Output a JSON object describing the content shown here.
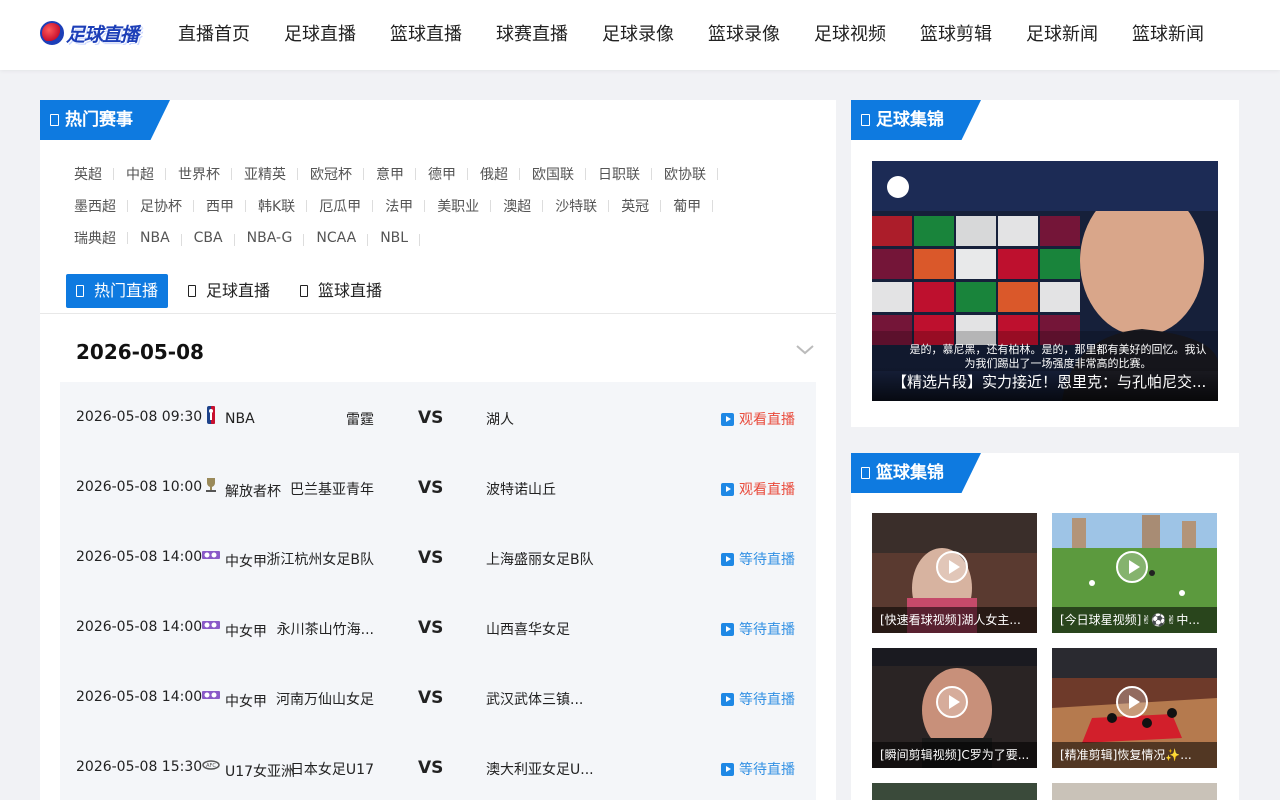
{
  "logo": {
    "text": "足球直播"
  },
  "nav": [
    "直播首页",
    "足球直播",
    "篮球直播",
    "球赛直播",
    "足球录像",
    "篮球录像",
    "足球视频",
    "篮球剪辑",
    "足球新闻",
    "篮球新闻"
  ],
  "hot_events": {
    "title": "热门赛事",
    "rows": [
      [
        "英超",
        "中超",
        "世界杯",
        "亚精英",
        "欧冠杯",
        "意甲",
        "德甲",
        "俄超",
        "欧国联",
        "日职联",
        "欧协联"
      ],
      [
        "墨西超",
        "足协杯",
        "西甲",
        "韩K联",
        "厄瓜甲",
        "法甲",
        "美职业",
        "澳超",
        "沙特联",
        "英冠",
        "葡甲"
      ],
      [
        "瑞典超",
        "NBA",
        "CBA",
        "NBA-G",
        "NCAA",
        "NBL"
      ]
    ]
  },
  "tabs": [
    "热门直播",
    "足球直播",
    "篮球直播"
  ],
  "date": "2026-05-08",
  "vs_label": "VS",
  "matches": [
    {
      "time": "2026-05-08 09:30",
      "league": "NBA",
      "home": "雷霆",
      "away": "湖人",
      "status": "观看直播",
      "state": "live",
      "icon": "nba-logo-icon"
    },
    {
      "time": "2026-05-08 10:00",
      "league": "解放者杯",
      "home": "巴兰基亚青年",
      "away": "波特诺山丘",
      "status": "观看直播",
      "state": "live",
      "icon": "trophy-icon"
    },
    {
      "time": "2026-05-08 14:00",
      "league": "中女甲",
      "home": "浙江杭州女足B队",
      "away": "上海盛丽女足B队",
      "status": "等待直播",
      "state": "wait",
      "icon": "league-badge-icon"
    },
    {
      "time": "2026-05-08 14:00",
      "league": "中女甲",
      "home": "永川茶山竹海...",
      "away": "山西喜华女足",
      "status": "等待直播",
      "state": "wait",
      "icon": "league-badge-icon"
    },
    {
      "time": "2026-05-08 14:00",
      "league": "中女甲",
      "home": "河南万仙山女足",
      "away": "武汉武体三镇...",
      "status": "等待直播",
      "state": "wait",
      "icon": "league-badge-icon"
    },
    {
      "time": "2026-05-08 15:30",
      "league": "U17女亚洲",
      "home": "日本女足U17",
      "away": "澳大利亚女足U...",
      "status": "等待直播",
      "state": "wait",
      "icon": "afc-logo-icon"
    }
  ],
  "football_highlights": {
    "title": "足球集锦",
    "featured": {
      "caption": "【精选片段】实力接近！恩里克：与孔帕尼交...",
      "subtitle1": "是的，慕尼黑，还有柏林。是的，那里都有美好的回忆。我认",
      "subtitle2": "为我们踢出了一场强度非常高的比赛。"
    }
  },
  "basketball_highlights": {
    "title": "篮球集锦",
    "items": [
      {
        "caption": "[快速看球视频]湖人女主..."
      },
      {
        "caption": "[今日球星视频]✌⚽✌中..."
      },
      {
        "caption": "[瞬间剪辑视频]C罗为了要..."
      },
      {
        "caption": "[精准剪辑]恢复情况✨..."
      }
    ]
  },
  "colors": {
    "accent": "#0e7ae0",
    "live": "#e94b3c",
    "wait": "#3391e4"
  }
}
